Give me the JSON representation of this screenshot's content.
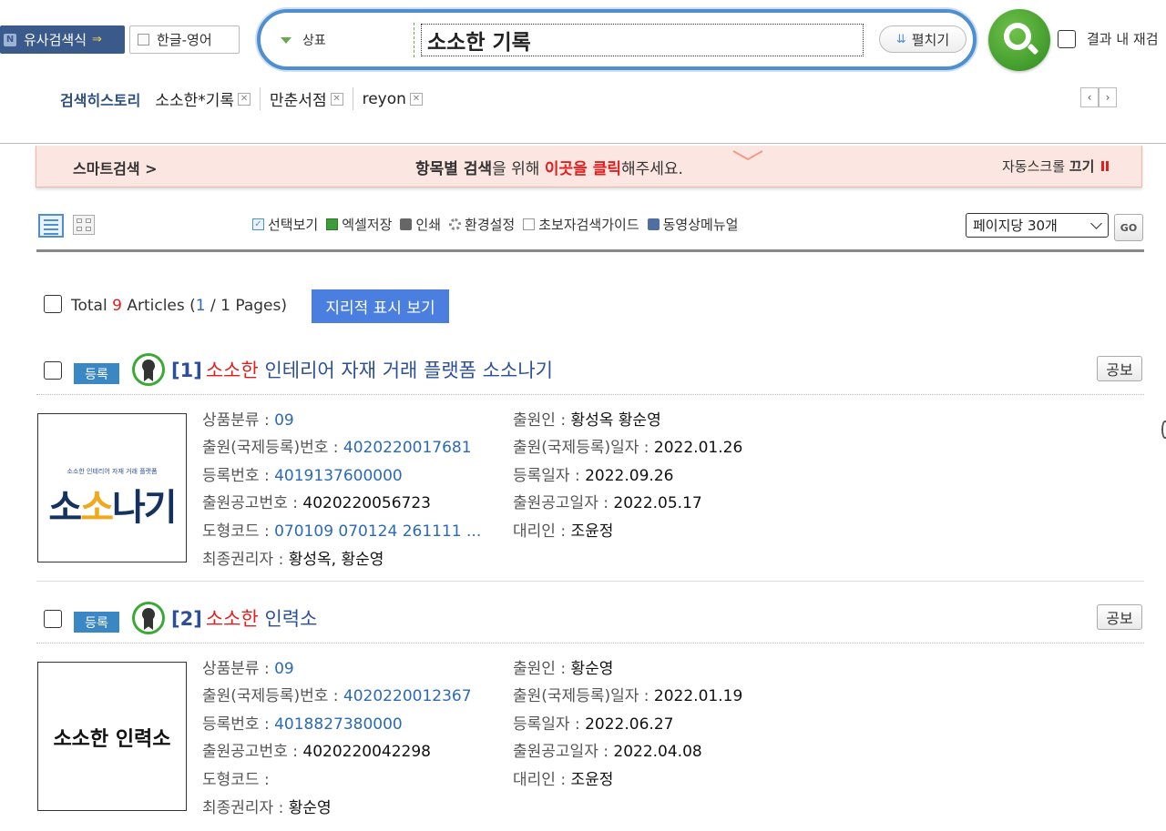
{
  "topbar": {
    "similar_search": "유사검색식",
    "hangul_english": "한글-영어",
    "search_type": "상표",
    "search_value": "소소한 기록",
    "expand_label": "펼치기",
    "in_result_label": "결과 내 재검"
  },
  "history": {
    "label": "검색히스토리",
    "items": [
      "소소한*기록",
      "만춘서점",
      "reyon"
    ]
  },
  "smart": {
    "left": "스마트검색 >",
    "mid_bold": "항목별 검색",
    "mid_text1": "을 위해 ",
    "mid_red": "이곳을 클릭",
    "mid_text2": "해주세요.",
    "right_text": "자동스크롤 ",
    "right_bold": "끄기"
  },
  "toolbar": {
    "tools": [
      "선택보기",
      "엑셀저장",
      "인쇄",
      "환경설정",
      "초보자검색가이드",
      "동영상메뉴얼"
    ],
    "per_page": "페이지당 30개",
    "go": "GO"
  },
  "total": {
    "prefix": "Total ",
    "count": "9",
    "mid": " Articles (",
    "page": "1",
    "suffix": " / 1 Pages)",
    "geo_button": "지리적 표시 보기"
  },
  "results": [
    {
      "status": "등록",
      "num": "[1]",
      "highlight": "소소한",
      "title_rest": " 인테리어 자재 거래 플랫폼 소소나기",
      "gongbo": "공보",
      "logo_small": "소소한 인테리어 자재 거래 플랫폼",
      "logo_big_a": "소",
      "logo_big_b": "소",
      "logo_big_c": "나기",
      "fields": {
        "product_class_k": "상품분류 : ",
        "product_class_v": "09",
        "app_no_k": "출원(국제등록)번호 : ",
        "app_no_v": "4020220017681",
        "reg_no_k": "등록번호 : ",
        "reg_no_v": "4019137600000",
        "pub_no_k": "출원공고번호 : ",
        "pub_no_v": "4020220056723",
        "fig_code_k": "도형코드 : ",
        "fig_code_v": "070109 070124 261111 ...",
        "owner_k": "최종권리자 : ",
        "owner_v": "황성옥, 황순영",
        "applicant_k": "출원인 : ",
        "applicant_v": "황성옥 황순영",
        "app_date_k": "출원(국제등록)일자 : ",
        "app_date_v": "2022.01.26",
        "reg_date_k": "등록일자 : ",
        "reg_date_v": "2022.09.26",
        "pub_date_k": "출원공고일자 : ",
        "pub_date_v": "2022.05.17",
        "agent_k": "대리인 : ",
        "agent_v": "조윤정"
      }
    },
    {
      "status": "등록",
      "num": "[2]",
      "highlight": "소소한",
      "title_rest": " 인력소",
      "gongbo": "공보",
      "logo_text": "소소한 인력소",
      "fields": {
        "product_class_k": "상품분류 : ",
        "product_class_v": "09",
        "app_no_k": "출원(국제등록)번호 : ",
        "app_no_v": "4020220012367",
        "reg_no_k": "등록번호 : ",
        "reg_no_v": "4018827380000",
        "pub_no_k": "출원공고번호 : ",
        "pub_no_v": "4020220042298",
        "fig_code_k": "도형코드 : ",
        "fig_code_v": "",
        "owner_k": "최종권리자 : ",
        "owner_v": "황순영",
        "applicant_k": "출원인 : ",
        "applicant_v": "황순영",
        "app_date_k": "출원(국제등록)일자 : ",
        "app_date_v": "2022.01.19",
        "reg_date_k": "등록일자 : ",
        "reg_date_v": "2022.06.27",
        "pub_date_k": "출원공고일자 : ",
        "pub_date_v": "2022.04.08",
        "agent_k": "대리인 : ",
        "agent_v": "조윤정"
      }
    }
  ]
}
